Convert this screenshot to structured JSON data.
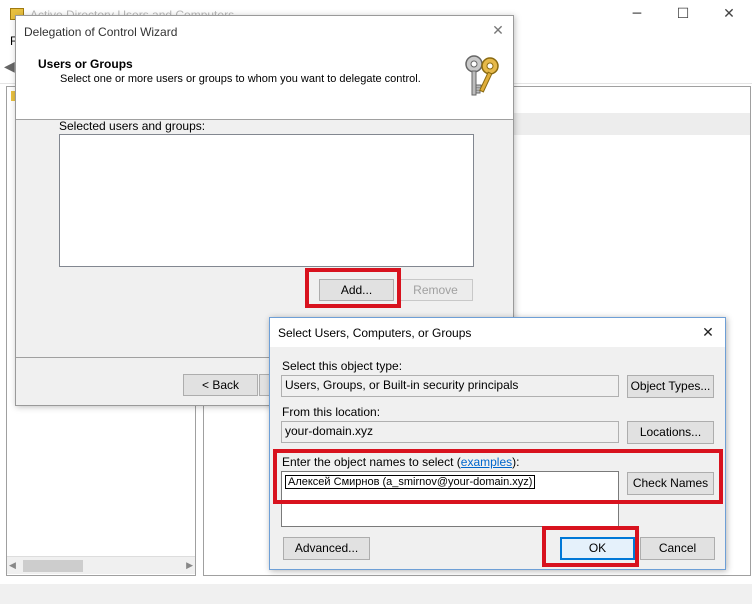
{
  "background_window": {
    "title": "Active Directory Users and Computers",
    "menu_first": "F",
    "min_glyph": "─",
    "max_glyph": "☐",
    "close_glyph": "✕",
    "back_glyph": "◀",
    "scroll_left_glyph": "◀",
    "scroll_right_glyph": "▶"
  },
  "wizard": {
    "title": "Delegation of Control Wizard",
    "close_glyph": "✕",
    "heading": "Users or Groups",
    "subheading": "Select one or more users or groups to whom you want to delegate control.",
    "icon": "keys-icon",
    "list_label": "Selected users and groups:",
    "add_label": "Add...",
    "remove_label": "Remove",
    "back_label": "< Back"
  },
  "select_dialog": {
    "title": "Select Users, Computers, or Groups",
    "close_glyph": "✕",
    "object_type_label": "Select this object type:",
    "object_type_value": "Users, Groups, or Built-in security principals",
    "object_types_button": "Object Types...",
    "location_label": "From this location:",
    "location_value": "your-domain.xyz",
    "locations_button": "Locations...",
    "names_label_pre": "Enter the object names to select (",
    "names_label_link": "examples",
    "names_label_post": "):",
    "names_value": "Алексей Смирнов (a_smirnov@your-domain.xyz)",
    "check_names_button": "Check Names",
    "advanced_button": "Advanced...",
    "ok_button": "OK",
    "cancel_button": "Cancel"
  },
  "colors": {
    "highlight": "#d8121e",
    "link": "#0066cc",
    "default_button_border": "#0078d7"
  }
}
